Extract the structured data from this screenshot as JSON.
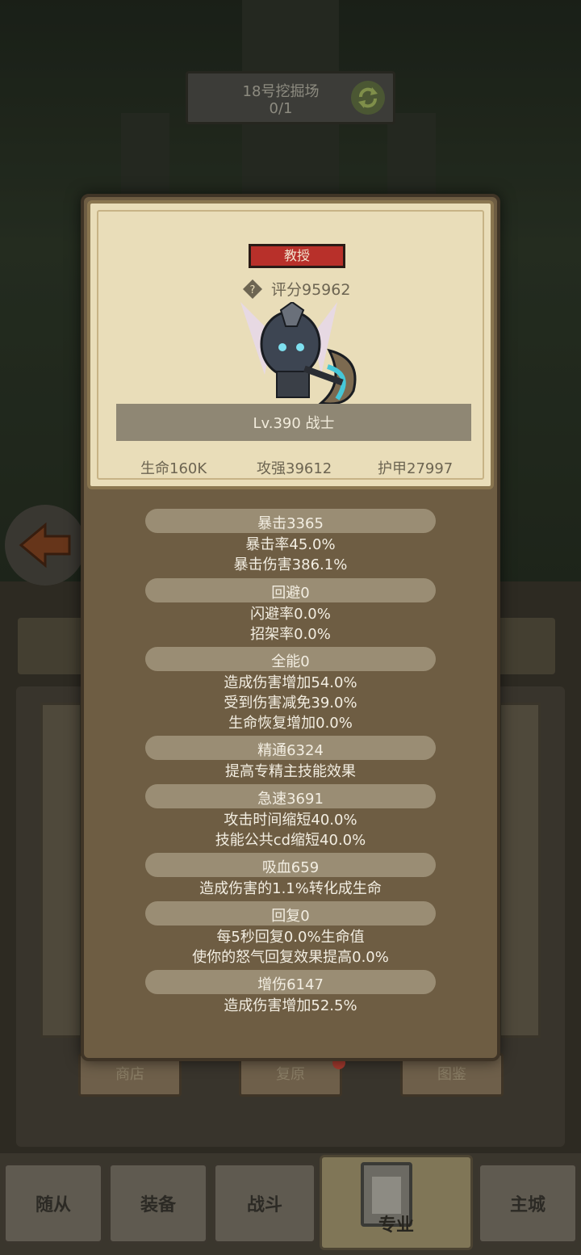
{
  "header": {
    "title": "18号挖掘场",
    "count": "0/1"
  },
  "hero": {
    "rank": "教授",
    "score": "评分95962",
    "level": "Lv.390 战士",
    "hp": "生命160K",
    "attack": "攻强39612",
    "armor": "护甲27997"
  },
  "details": [
    {
      "title": "暴击3365",
      "lines": [
        "暴击率45.0%",
        "暴击伤害386.1%"
      ]
    },
    {
      "title": "回避0",
      "lines": [
        "闪避率0.0%",
        "招架率0.0%"
      ]
    },
    {
      "title": "全能0",
      "lines": [
        "造成伤害增加54.0%",
        "受到伤害减免39.0%",
        "生命恢复增加0.0%"
      ]
    },
    {
      "title": "精通6324",
      "lines": [
        "提高专精主技能效果"
      ]
    },
    {
      "title": "急速3691",
      "lines": [
        "攻击时间缩短40.0%",
        "技能公共cd缩短40.0%"
      ]
    },
    {
      "title": "吸血659",
      "lines": [
        "造成伤害的1.1%转化成生命"
      ]
    },
    {
      "title": "回复0",
      "lines": [
        "每5秒回复0.0%生命值",
        "使你的怒气回复效果提高0.0%"
      ]
    },
    {
      "title": "增伤6147",
      "lines": [
        "造成伤害增加52.5%"
      ]
    }
  ],
  "sub_buttons": [
    "商店",
    "复原",
    "图鉴"
  ],
  "nav": {
    "followers": "随从",
    "equipment": "装备",
    "battle": "战斗",
    "profession": "专业",
    "main_city": "主城"
  },
  "colors": {
    "rank_badge": "#b8302a",
    "popup_bg": "#6e5d43",
    "card_bg": "#e9ddb9"
  },
  "icons": {
    "refresh": "refresh-icon",
    "back": "back-arrow-icon",
    "help": "question-diamond-icon"
  }
}
